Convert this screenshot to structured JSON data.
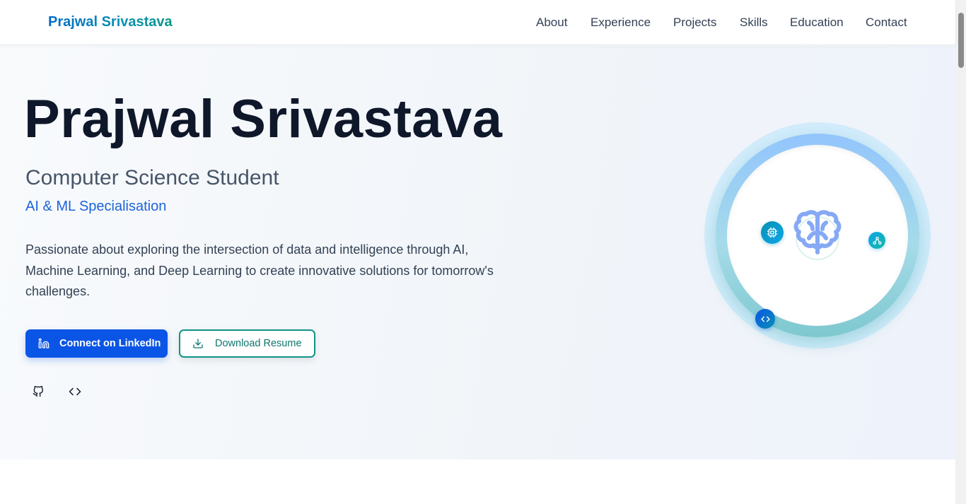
{
  "nav": {
    "brand": "Prajwal Srivastava",
    "links": [
      {
        "label": "About"
      },
      {
        "label": "Experience"
      },
      {
        "label": "Projects"
      },
      {
        "label": "Skills"
      },
      {
        "label": "Education"
      },
      {
        "label": "Contact"
      }
    ]
  },
  "hero": {
    "title": "Prajwal Srivastava",
    "subtitle": "Computer Science Student",
    "specialisation": "AI & ML Specialisation",
    "description": "Passionate about exploring the intersection of data and intelligence through AI, Machine Learning, and Deep Learning to create innovative solutions for tomorrow's challenges.",
    "primary_button": {
      "label": "Connect on LinkedIn",
      "icon": "linkedin-icon"
    },
    "secondary_button": {
      "label": "Download Resume",
      "icon": "download-icon"
    },
    "social_icons": [
      "github-icon",
      "code-icon"
    ]
  },
  "visual": {
    "center_icon": "brain-icon",
    "orbit_icons": [
      "cpu-icon",
      "network-icon",
      "code-icon"
    ]
  },
  "colors": {
    "primary": "#0b55e6",
    "teal": "#0f9488",
    "heading": "#0f172a",
    "accent_blue": "#1d64d8"
  }
}
